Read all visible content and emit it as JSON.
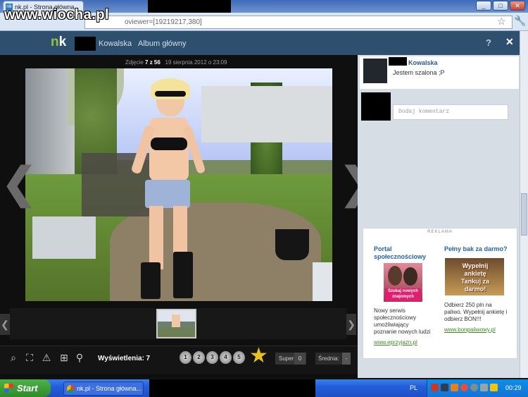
{
  "browser": {
    "tab_title": "nk.pl - Strona główna",
    "tab_favicon": "nk",
    "address_text": "oviewer=[19219217,380]",
    "star_icon": "star-icon",
    "wrench_icon": "wrench-icon",
    "window_min": "_",
    "window_max": "□",
    "window_close": "✕",
    "watermark": "www.wiocha.pl"
  },
  "nk_header": {
    "logo_n": "n",
    "logo_k": "k",
    "user_name": "Kowalska",
    "album_link": "Album główny",
    "help_label": "?",
    "close_label": "✕"
  },
  "viewer": {
    "photo_label": "Zdjęcie",
    "photo_index": "7 z 56",
    "photo_date": "19 sierpnia 2012 o 23:09",
    "prev_arrow": "❮",
    "next_arrow": "❯",
    "thumb_prev": "❮",
    "thumb_next": "❯",
    "views_label": "Wyświetlenia:",
    "views_value": "7",
    "rating_stars": [
      "1",
      "2",
      "3",
      "4",
      "5"
    ],
    "super_label": "Super",
    "super_value": "0",
    "average_label": "Średnia:",
    "average_value": "-"
  },
  "side": {
    "author_name": "Kowalska",
    "author_status": "Jestem szalona ;P",
    "comment_placeholder": "Dodaj komentarz",
    "ad": {
      "label": "REKLAMA",
      "col1_title": "Portal społecznościowy",
      "col1_img_text": "Szukaj nowych znajomych",
      "col1_text": "Nowy serwis społecznościowy umożliwiający poznanie nowych ludzi",
      "col1_link": "www.eprzyjazn.pl",
      "col2_title": "Pełny bak za darmo?",
      "col2_img_text": "Wypełnij ankietę Tankuj za darmo!",
      "col2_text": "Odbierz 250 pln na paliwo. Wypełnij ankietę i odbierz BON!!!",
      "col2_link": "www.bonpaliwowy.pl"
    }
  },
  "taskbar": {
    "start_label": "Start",
    "task_label": "nk.pl - Strona główna...",
    "lang": "PL",
    "clock": "00:29"
  }
}
